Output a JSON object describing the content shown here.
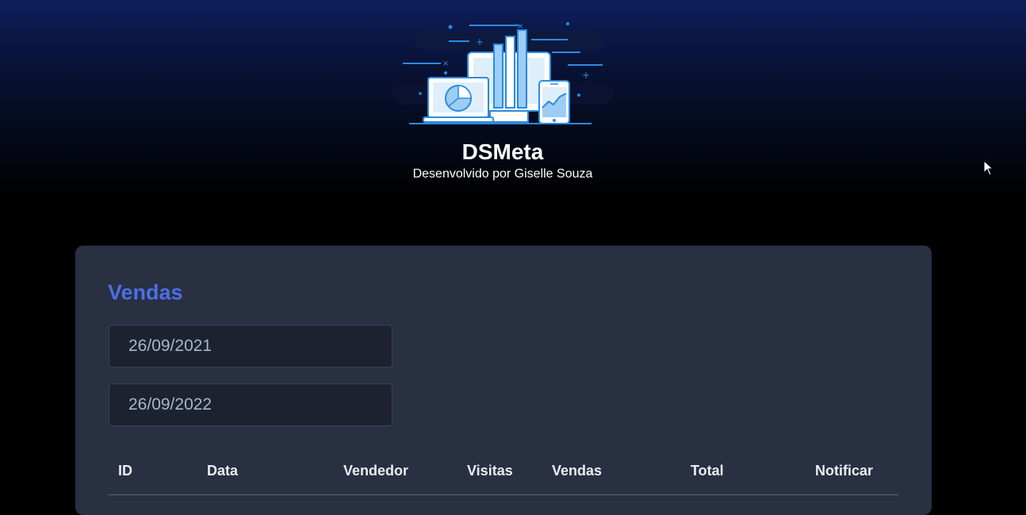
{
  "header": {
    "title": "DSMeta",
    "subtitle": "Desenvolvido por Giselle Souza"
  },
  "sales": {
    "title": "Vendas",
    "min_date": "26/09/2021",
    "max_date": "26/09/2022",
    "columns": [
      "ID",
      "Data",
      "Vendedor",
      "Visitas",
      "Vendas",
      "Total",
      "Notificar"
    ]
  },
  "colors": {
    "accent": "#4d6ee6",
    "card_background": "#283041",
    "input_background": "#1c2230"
  }
}
